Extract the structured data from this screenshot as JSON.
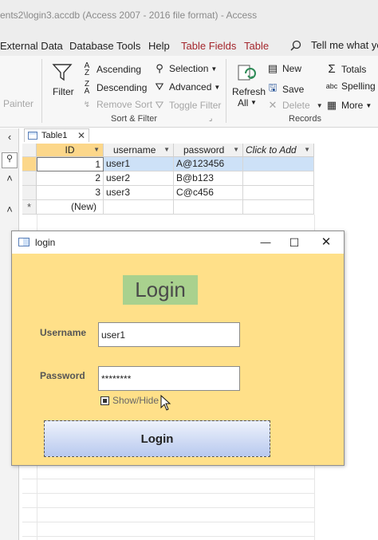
{
  "window": {
    "title": "ents2\\login3.accdb (Access 2007 - 2016 file format) - Access"
  },
  "menu": {
    "tabs": [
      "External Data",
      "Database Tools",
      "Help",
      "Table Fields",
      "Table"
    ],
    "tell_me": "Tell me what you"
  },
  "ribbon": {
    "painter": "Painter",
    "filter": "Filter",
    "ascending": "Ascending",
    "descending": "Descending",
    "remove_sort": "Remove Sort",
    "selection": "Selection",
    "advanced": "Advanced",
    "toggle_filter": "Toggle Filter",
    "sort_filter_group": "Sort & Filter",
    "refresh_all": [
      "Refresh",
      "All"
    ],
    "new": "New",
    "save": "Save",
    "delete": "Delete",
    "totals": "Totals",
    "spelling": "Spelling",
    "more": "More",
    "records_group": "Records",
    "colors": {
      "accent_red": "#a4262c"
    }
  },
  "datasheet": {
    "tab_label": "Table1",
    "columns": [
      "ID",
      "username",
      "password",
      "Click to Add"
    ],
    "rows": [
      {
        "id": "1",
        "username": "user1",
        "password": "A@123456"
      },
      {
        "id": "2",
        "username": "user2",
        "password": "B@b123"
      },
      {
        "id": "3",
        "username": "user3",
        "password": "C@c456"
      }
    ],
    "new_row": "(New)",
    "new_row_marker": "*"
  },
  "login_form": {
    "window_title": "login",
    "title": "Login",
    "username_label": "Username",
    "username_value": "user1",
    "password_label": "Password",
    "password_value": "********",
    "show_hide": "Show/Hide",
    "login_button": "Login",
    "colors": {
      "background": "#ffe089",
      "title_bg": "#a9d18e"
    }
  }
}
